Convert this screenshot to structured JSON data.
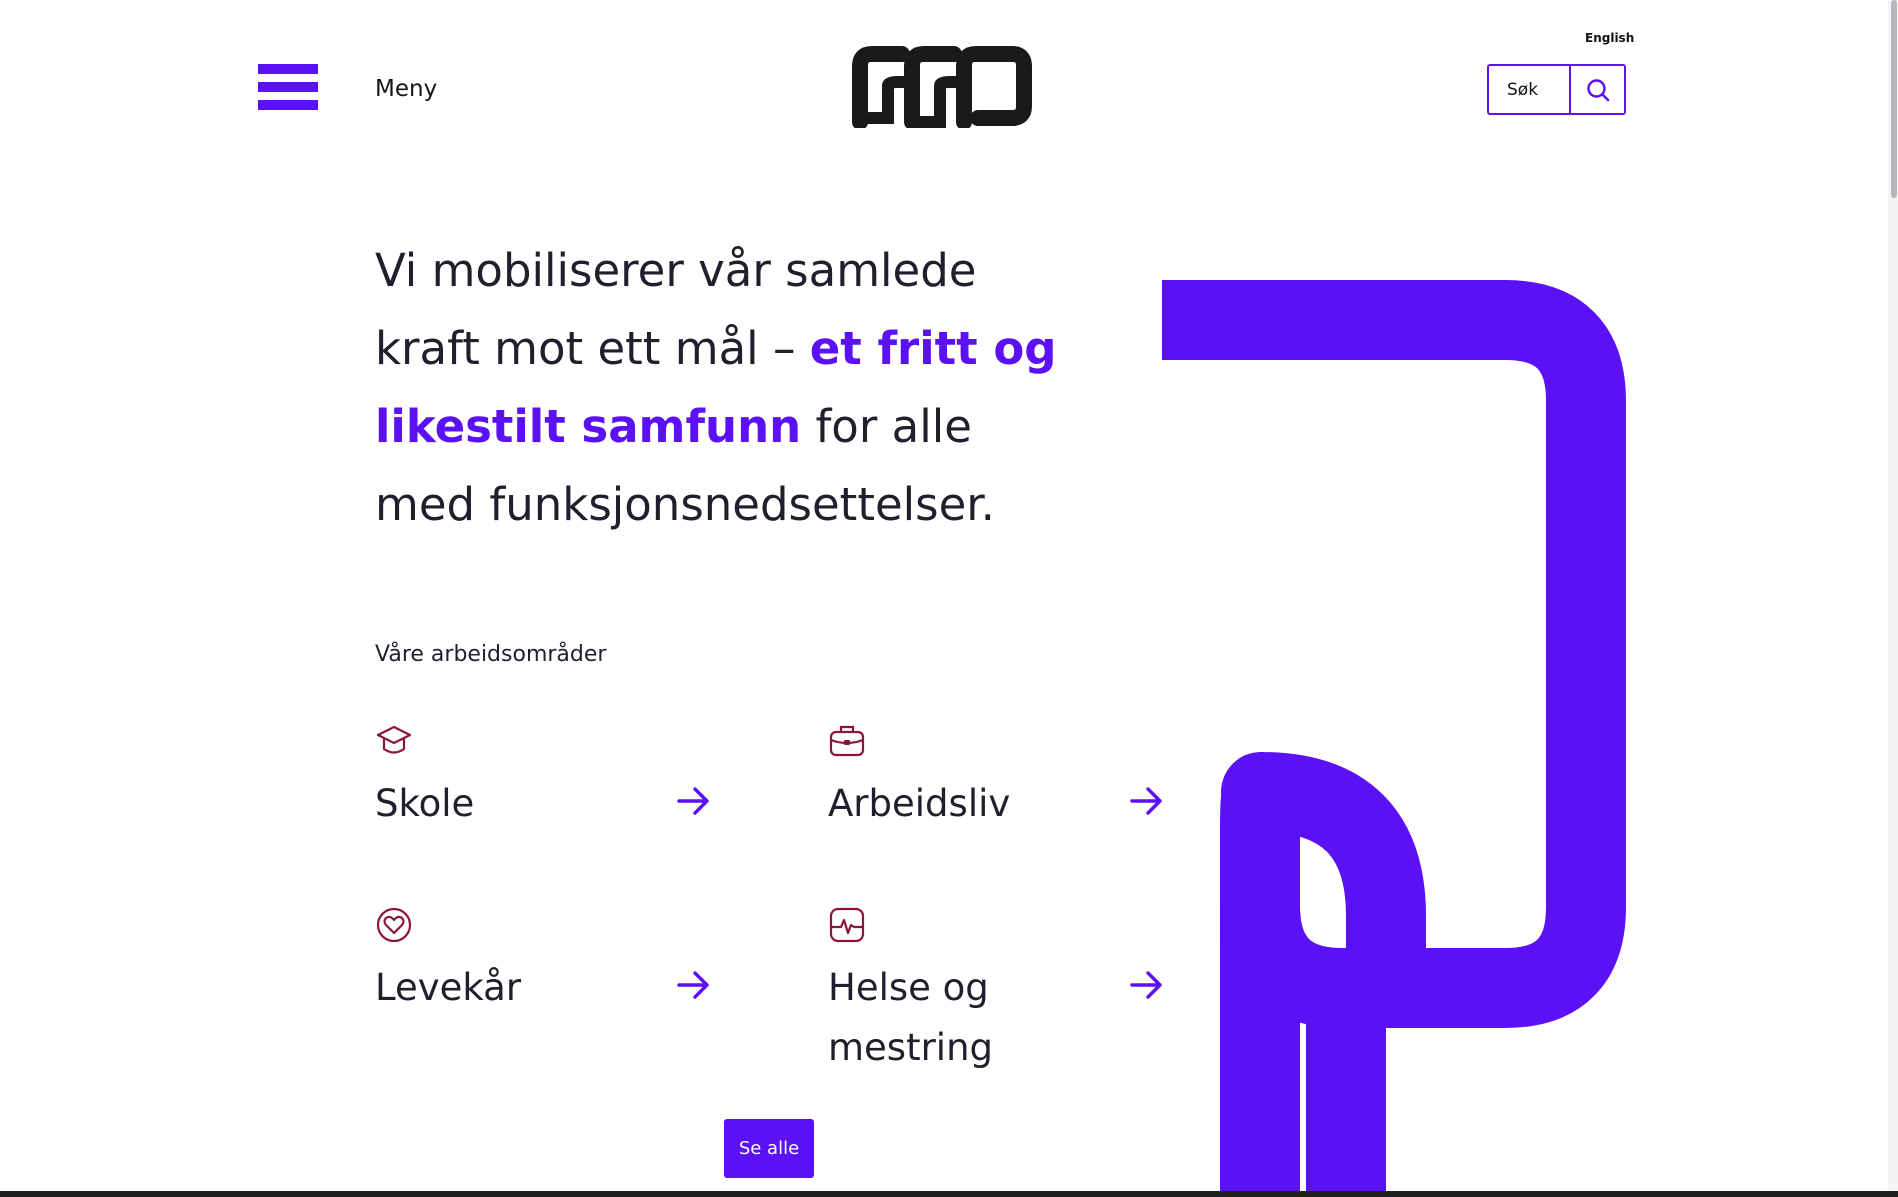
{
  "header": {
    "menu_label": "Meny",
    "language_link": "English",
    "search_placeholder": "Søk"
  },
  "hero": {
    "text_before": "Vi mobiliserer vår samlede kraft mot ett mål – ",
    "highlight": "et fritt og likestilt samfunn",
    "text_after": " for alle med funksjonsnedsettelser."
  },
  "work_areas": {
    "label": "Våre arbeidsområder",
    "items": [
      {
        "title": "Skole",
        "icon": "graduation-cap-icon"
      },
      {
        "title": "Arbeidsliv",
        "icon": "briefcase-icon"
      },
      {
        "title": "Levekår",
        "icon": "heart-circle-icon"
      },
      {
        "title": "Helse og mestring",
        "icon": "heartbeat-icon"
      }
    ],
    "see_all_label": "Se alle"
  },
  "colors": {
    "accent": "#5b10f5",
    "icon": "#8a1538",
    "text": "#1f1f2e"
  }
}
